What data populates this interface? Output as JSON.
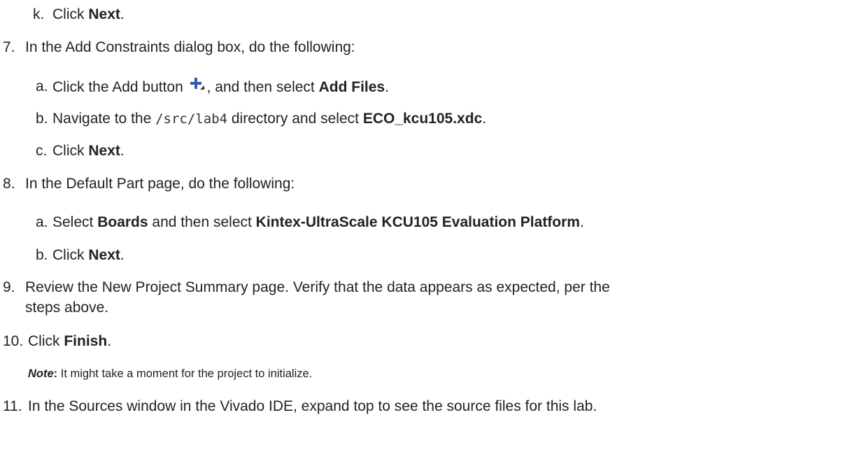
{
  "step_k": {
    "marker": "k.",
    "pre": "Click ",
    "bold": "Next",
    "post": "."
  },
  "step_7": {
    "marker": "7.",
    "text": "In the Add Constraints dialog box, do the following:",
    "sub_a": {
      "marker": "a.",
      "pre": "Click the Add button",
      "mid": ", and then select ",
      "bold": "Add Files",
      "post": "."
    },
    "sub_b": {
      "marker": "b.",
      "pre": "Navigate to the ",
      "code": "/src/lab4",
      "mid": " directory and select ",
      "bold": "ECO_kcu105.xdc",
      "post": "."
    },
    "sub_c": {
      "marker": "c.",
      "pre": "Click ",
      "bold": "Next",
      "post": "."
    }
  },
  "step_8": {
    "marker": "8.",
    "text": "In the Default Part page, do the following:",
    "sub_a": {
      "marker": "a.",
      "pre": "Select ",
      "bold1": "Boards",
      "mid": " and then select ",
      "bold2": "Kintex-UltraScale KCU105 Evaluation Platform",
      "post": "."
    },
    "sub_b": {
      "marker": "b.",
      "pre": "Click ",
      "bold": "Next",
      "post": "."
    }
  },
  "step_9": {
    "marker": "9.",
    "line1": "Review the New Project Summary page. Verify that the data appears as expected, per the",
    "line2": "steps above."
  },
  "step_10": {
    "marker": "10.",
    "pre": "Click ",
    "bold": "Finish",
    "post": "."
  },
  "note": {
    "label": "Note",
    "colon": ":",
    "text": " It might take a moment for the project to initialize."
  },
  "step_11": {
    "marker": "11.",
    "text": "In the Sources window in the Vivado IDE, expand top to see the source files for this lab."
  },
  "icons": {
    "add": "add-plus-icon"
  },
  "colors": {
    "text": "#222222",
    "icon_blue": "#2f5fa8"
  }
}
